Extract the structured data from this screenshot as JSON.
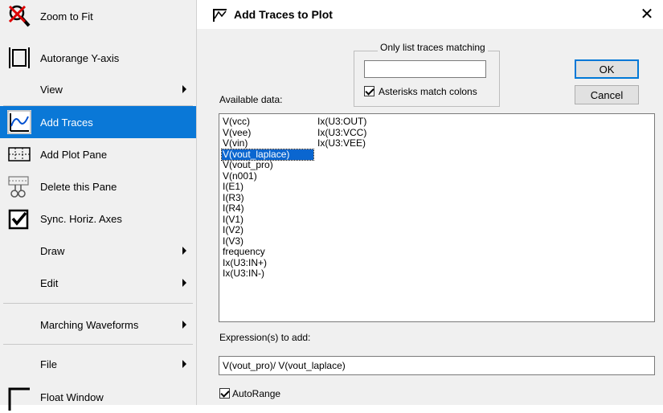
{
  "menu": {
    "items": [
      {
        "label": "Zoom to Fit",
        "icon": "zoom-to-fit-icon"
      },
      {
        "label": "Autorange Y-axis",
        "icon": "autorange-icon"
      },
      {
        "label": "View",
        "submenu": true
      },
      {
        "label": "Add Traces",
        "icon": "add-traces-icon",
        "selected": true
      },
      {
        "label": "Add Plot Pane",
        "icon": "add-plot-pane-icon"
      },
      {
        "label": "Delete this Pane",
        "icon": "delete-pane-icon"
      },
      {
        "label": "Sync. Horiz. Axes",
        "icon": "checkmark-icon",
        "checked": true
      },
      {
        "label": "Draw",
        "submenu": true
      },
      {
        "label": "Edit",
        "submenu": true
      },
      {
        "label": "Marching Waveforms",
        "submenu": true
      },
      {
        "label": "File",
        "submenu": true
      },
      {
        "label": "Float Window",
        "icon": "float-window-icon"
      }
    ]
  },
  "dialog": {
    "title": "Add Traces to Plot",
    "close": "✕",
    "filter": {
      "legend": "Only list traces matching",
      "value": "",
      "asterisk_label": "Asterisks match colons",
      "asterisk_checked": true
    },
    "ok": "OK",
    "cancel": "Cancel",
    "available_label": "Available data:",
    "traces_col1": [
      "V(vcc)",
      "V(vee)",
      "V(vin)",
      "V(vout_laplace)",
      "V(vout_pro)",
      "V(n001)",
      "I(E1)",
      "I(R3)",
      "I(R4)",
      "I(V1)",
      "I(V2)",
      "I(V3)",
      "frequency",
      "Ix(U3:IN+)",
      "Ix(U3:IN-)"
    ],
    "traces_col2": [
      "Ix(U3:OUT)",
      "Ix(U3:VCC)",
      "Ix(U3:VEE)"
    ],
    "selected_trace": "V(vout_laplace)",
    "expression_label": "Expression(s) to add:",
    "expression_value": "V(vout_pro)/ V(vout_laplace)",
    "autorange_label": "AutoRange",
    "autorange_checked": true
  },
  "colors": {
    "selection": "#0a78d7",
    "ok_border": "#0078d7"
  }
}
